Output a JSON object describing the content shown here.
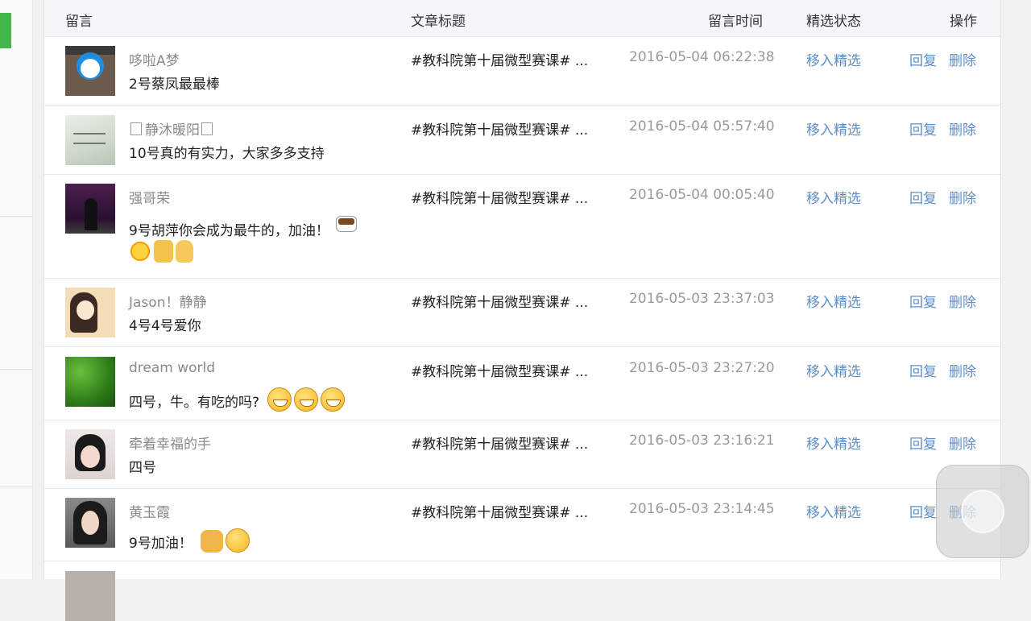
{
  "header": {
    "col_comment": "留言",
    "col_title": "文章标题",
    "col_time": "留言时间",
    "col_status": "精选状态",
    "col_action": "操作"
  },
  "actions": {
    "feature": "移入精选",
    "reply": "回复",
    "delete": "删除"
  },
  "rows": [
    {
      "nick": "哆啦A梦",
      "message": "2号蔡凤最最棒",
      "article": "#教科院第十届微型赛课# ...",
      "time": "2016-05-04 06:22:38",
      "feature": "移入精选",
      "reply": "回复",
      "delete": "删除",
      "emoji": []
    },
    {
      "nick_main": "静沐暖阳",
      "message": "10号真的有实力，大家多多支持",
      "article": "#教科院第十届微型赛课# ...",
      "time": "2016-05-04 05:57:40",
      "feature": "移入精选",
      "reply": "回复",
      "delete": "删除",
      "emoji": []
    },
    {
      "nick": "强哥荣",
      "message": "9号胡萍你会成为最牛的，加油！",
      "article": "#教科院第十届微型赛课# ...",
      "time": "2016-05-04 00:05:40",
      "feature": "移入精选",
      "reply": "回复",
      "delete": "删除",
      "emoji": [
        "coffee-emoji",
        "sun-emoji",
        "thumbs-up-emoji",
        "victory-emoji"
      ]
    },
    {
      "nick": "Jason！静静",
      "message": "4号4号爱你",
      "article": "#教科院第十届微型赛课# ...",
      "time": "2016-05-03 23:37:03",
      "feature": "移入精选",
      "reply": "回复",
      "delete": "删除",
      "emoji": []
    },
    {
      "nick": "dream world",
      "message": "四号，牛。有吃的吗?",
      "article": "#教科院第十届微型赛课# ...",
      "time": "2016-05-03 23:27:20",
      "feature": "移入精选",
      "reply": "回复",
      "delete": "删除",
      "emoji": [
        "grin-emoji",
        "grin-emoji",
        "grin-emoji"
      ]
    },
    {
      "nick": "牵着幸福的手",
      "message": "四号",
      "article": "#教科院第十届微型赛课# ...",
      "time": "2016-05-03 23:16:21",
      "feature": "移入精选",
      "reply": "回复",
      "delete": "删除",
      "emoji": []
    },
    {
      "nick": "黄玉霞",
      "message": "9号加油！",
      "article": "#教科院第十届微型赛课# ...",
      "time": "2016-05-03 23:14:45",
      "feature": "移入精选",
      "reply": "回复",
      "delete": "删除",
      "emoji": [
        "fist-emoji",
        "hiccup-emoji"
      ]
    }
  ]
}
